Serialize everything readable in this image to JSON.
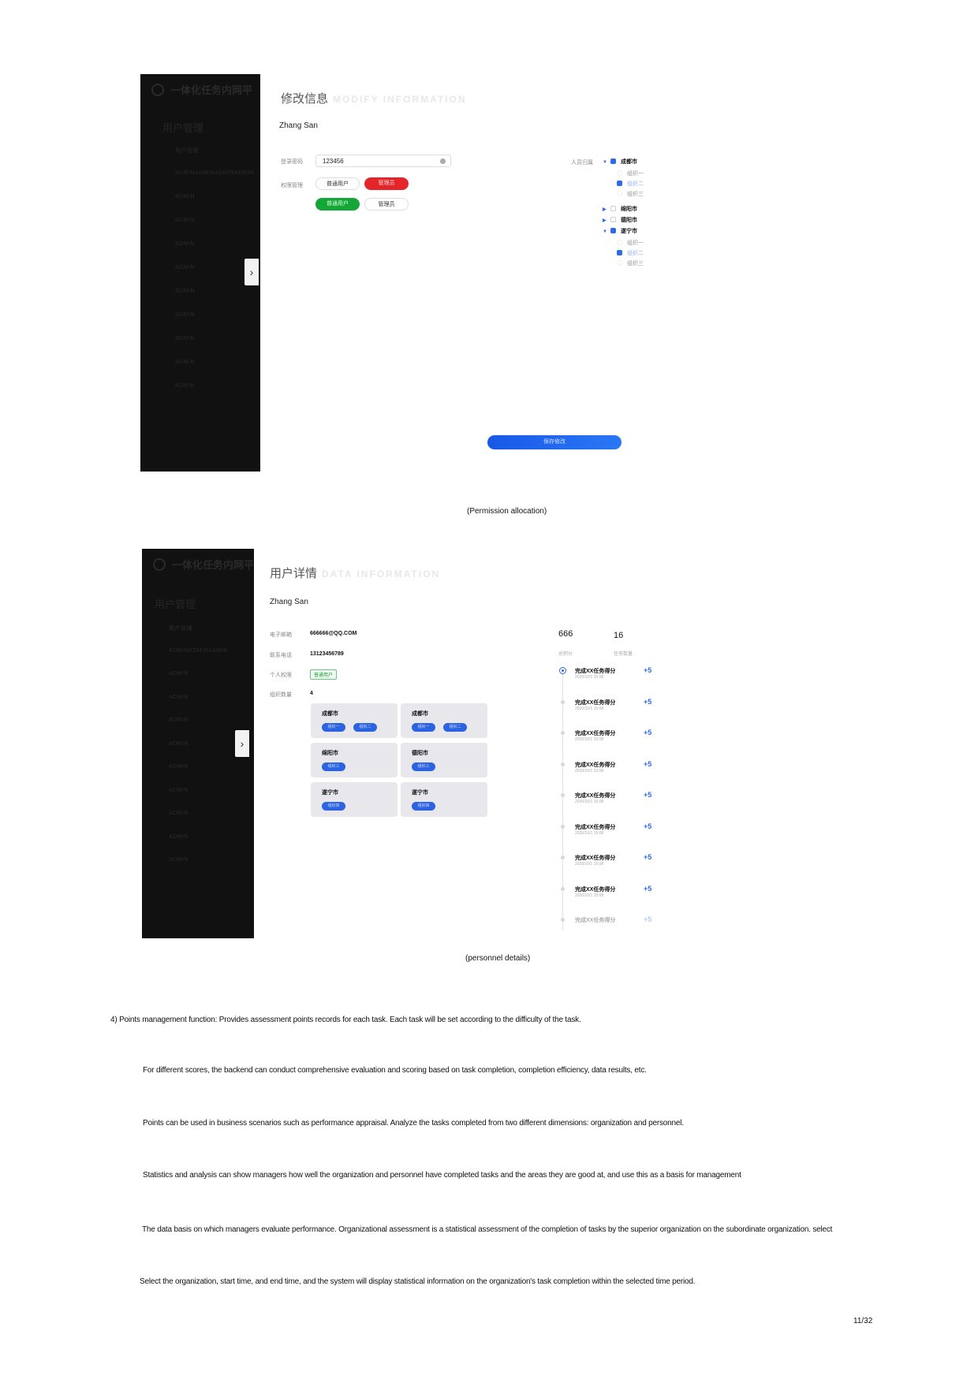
{
  "screenshot1": {
    "brand": "一体化任务内网平",
    "sidebar_group": "用户管理",
    "sidebar_items": [
      "用户管理",
      "ADMINADMINADMINADMIN",
      "ADMIN",
      "ADMIN",
      "ADMIN",
      "ADMIN",
      "ADMIN",
      "ADMIN",
      "ADMIN",
      "ADMIN",
      "ADMIN"
    ],
    "expand_icon": "chevron-right-icon",
    "expand_glyph": "›",
    "title_cn": "修改信息",
    "title_en": "MODIFY INFORMATION",
    "user_name": "Zhang San",
    "password_label": "登录密码",
    "password_value": "123456",
    "permission_label": "权限管理",
    "role_pills": [
      "普通用户",
      "管理员",
      "普通用户",
      "管理员"
    ],
    "tree_label": "人员归属",
    "tree": [
      {
        "label": "成都市",
        "checked": true,
        "expanded": true,
        "children": [
          {
            "label": "组织一",
            "checked": false
          },
          {
            "label": "组织二",
            "checked": true
          },
          {
            "label": "组织三",
            "checked": false
          }
        ]
      },
      {
        "label": "绵阳市",
        "checked": false,
        "expanded": false
      },
      {
        "label": "德阳市",
        "checked": false,
        "expanded": false
      },
      {
        "label": "遂宁市",
        "checked": true,
        "expanded": true,
        "children": [
          {
            "label": "组织一",
            "checked": false
          },
          {
            "label": "组织二",
            "checked": true
          },
          {
            "label": "组织三",
            "checked": false
          }
        ]
      }
    ],
    "save_label": "保存修改",
    "accent": "#2e6be6"
  },
  "caption1": "(Permission allocation)",
  "screenshot2": {
    "brand": "一体化任务内网平",
    "sidebar_group": "用户管理",
    "sidebar_items": [
      "用户管理",
      "ADMINADMINADMIN",
      "ADMIN",
      "ADMIN",
      "ADMIN",
      "ADMIN",
      "ADMIN",
      "ADMIN",
      "ADMIN",
      "ADMIN",
      "ADMIN"
    ],
    "expand_glyph": "›",
    "title_cn": "用户详情",
    "title_en": "DATA INFORMATION",
    "user_name": "Zhang San",
    "email_label": "电子邮箱",
    "email_value": "666666@QQ.COM",
    "phone_label": "联系电话",
    "phone_value": "13123456789",
    "permission_label": "个人权限",
    "permission_value": "普通用户",
    "org_count_label": "组织数量",
    "org_count_value": "4",
    "orgs": [
      {
        "city": "成都市",
        "chips": [
          "组织一",
          "组织二"
        ]
      },
      {
        "city": "成都市",
        "chips": [
          "组织一",
          "组织二"
        ]
      },
      {
        "city": "绵阳市",
        "chips": [
          "组织三"
        ]
      },
      {
        "city": "德阳市",
        "chips": [
          "组织三"
        ]
      },
      {
        "city": "遂宁市",
        "chips": [
          "组织四"
        ]
      },
      {
        "city": "遂宁市",
        "chips": [
          "组织四"
        ]
      }
    ],
    "stats": [
      {
        "value": "666",
        "label": "总积分"
      },
      {
        "value": "16",
        "label": "任务数量"
      }
    ],
    "timeline": [
      {
        "title": "完成XX任务得分",
        "date": "2020/10/1 15:08",
        "points": "+50"
      },
      {
        "title": "完成XX任务得分",
        "date": "2020/10/1 15:08",
        "points": "+50"
      },
      {
        "title": "完成XX任务得分",
        "date": "2020/10/1 15:08",
        "points": "+50"
      },
      {
        "title": "完成XX任务得分",
        "date": "2020/10/1 15:08",
        "points": "+50"
      },
      {
        "title": "完成XX任务得分",
        "date": "2020/10/1 15:08",
        "points": "+50"
      },
      {
        "title": "完成XX任务得分",
        "date": "2020/10/1 15:08",
        "points": "+50"
      },
      {
        "title": "完成XX任务得分",
        "date": "2020/10/1 15:08",
        "points": "+50"
      },
      {
        "title": "完成XX任务得分",
        "date": "2020/10/1 15:08",
        "points": "+50"
      },
      {
        "title": "完成XX任务得分",
        "date": "",
        "points": "+50"
      }
    ]
  },
  "caption2": "(personnel details)",
  "paragraphs": [
    "4) Points management function: Provides assessment points records for each task. Each task will be set according to the difficulty of the task.",
    "For different scores, the backend can conduct comprehensive evaluation and scoring based on task completion, completion efficiency, data results, etc.",
    "Points can be used in business scenarios such as performance appraisal. Analyze the tasks completed from two different dimensions: organization and personnel.",
    "Statistics and analysis can show managers how well the organization and personnel have completed tasks and the areas they are good at, and use this as a basis for management",
    "The data basis on which managers evaluate performance. Organizational assessment is a statistical assessment of the completion of tasks by the superior organization on the subordinate organization. select",
    "Select the organization, start time, and end time, and the system will display statistical information on the organization's task completion within the selected time period."
  ],
  "page_number": "11/32"
}
